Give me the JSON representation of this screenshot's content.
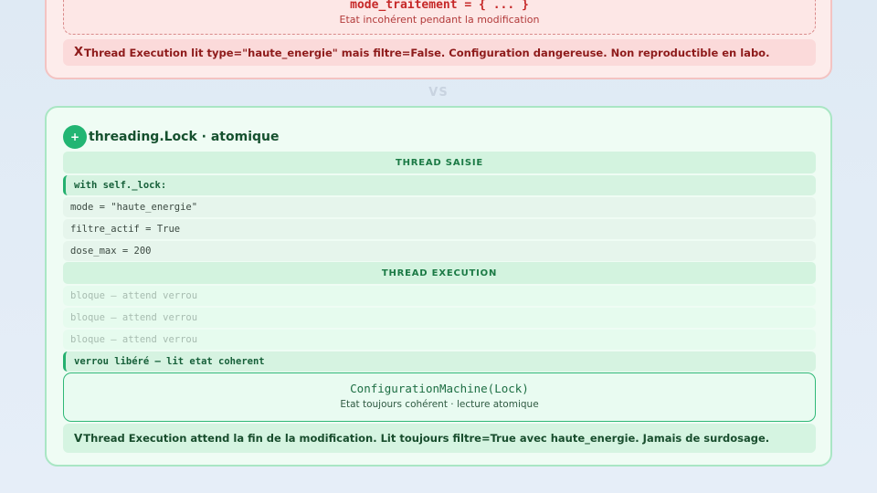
{
  "bad": {
    "machine_title": "mode_traitement = { ... }",
    "machine_subtitle": "Etat incohérent pendant la modification",
    "verdict_mark": "X",
    "verdict_text": "Thread Execution lit type=\"haute_energie\" mais filtre=False. Configuration dangereuse. Non reproductible en labo."
  },
  "vs_label": "VS",
  "good": {
    "badge": "+",
    "title": "threading.Lock · atomique",
    "section_saisie": "THREAD SAISIE",
    "saisie_rows": [
      "with self._lock:",
      "mode = \"haute_energie\"",
      "filtre_actif = True",
      "dose_max = 200"
    ],
    "section_execution": "THREAD EXECUTION",
    "execution_rows": [
      "bloque — attend verrou",
      "bloque — attend verrou",
      "bloque — attend verrou",
      "verrou libéré — lit etat coherent"
    ],
    "machine_title": "ConfigurationMachine(Lock)",
    "machine_subtitle": "Etat toujours cohérent · lecture atomique",
    "verdict_mark": "V",
    "verdict_text": "Thread Execution attend la fin de la modification. Lit toujours filtre=True avec haute_energie. Jamais de surdosage."
  }
}
